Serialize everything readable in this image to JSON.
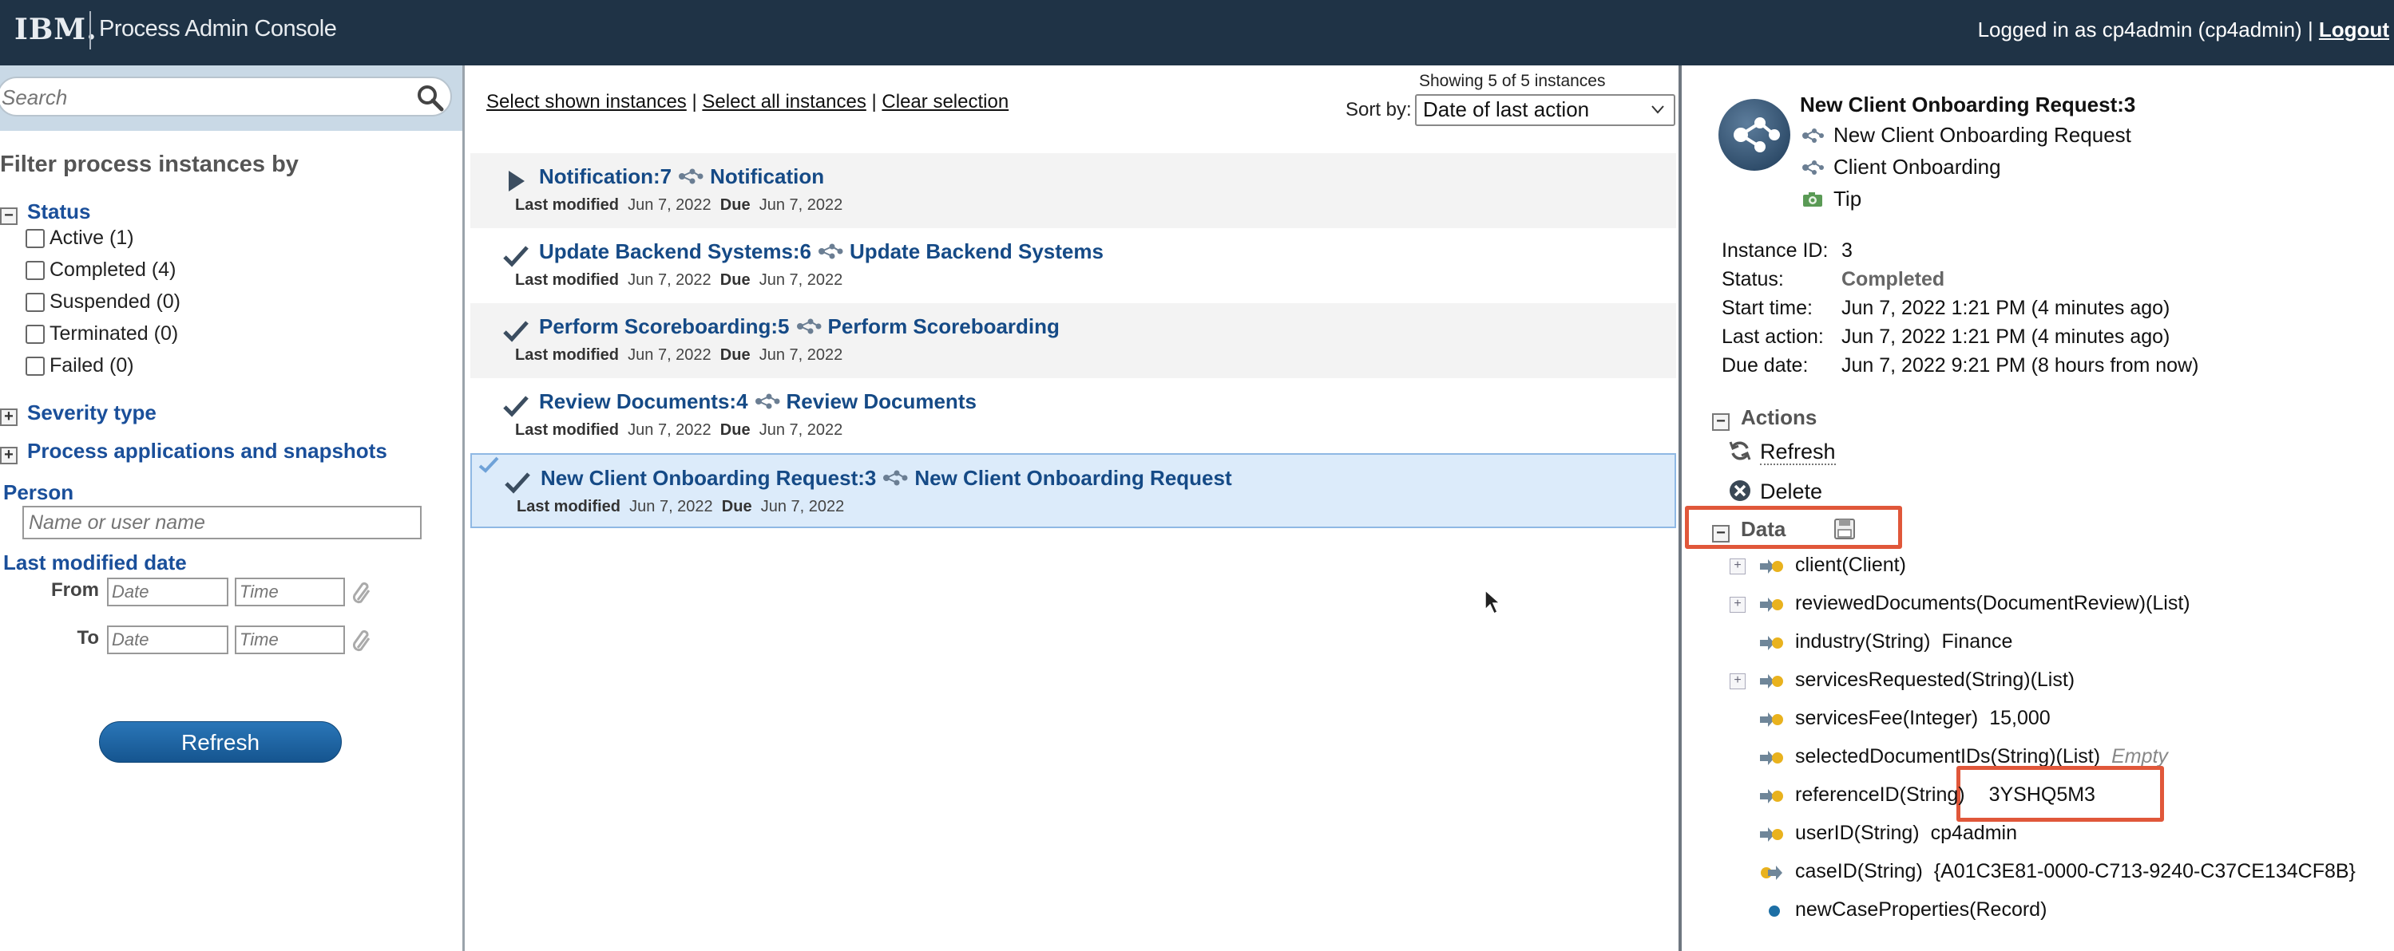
{
  "header": {
    "logo": "IBM.",
    "app_title": "Process Admin Console",
    "logged_in_text": "Logged in as cp4admin (cp4admin) | ",
    "logout_label": "Logout"
  },
  "left_panel": {
    "search_placeholder": "Search",
    "filter_title": "Filter process instances by",
    "status_section": "Status",
    "status_items": [
      "Active (1)",
      "Completed (4)",
      "Suspended (0)",
      "Terminated (0)",
      "Failed (0)"
    ],
    "severity_section": "Severity type",
    "apps_section": "Process applications and snapshots",
    "person_label": "Person",
    "person_placeholder": "Name or user name",
    "last_modified_label": "Last modified date",
    "from_label": "From",
    "to_label": "To",
    "date_placeholder": "Date",
    "time_placeholder": "Time",
    "refresh_label": "Refresh"
  },
  "middle_panel": {
    "select_shown": "Select shown instances",
    "select_all": "Select all instances",
    "clear_selection": "Clear selection",
    "separator": " | ",
    "showing": "Showing 5 of 5 instances",
    "sort_by_label": "Sort by:",
    "sort_value": "Date of last action",
    "last_modified_label": "Last modified",
    "due_label": "Due",
    "instances": [
      {
        "id_name": "Notification:7",
        "process": "Notification",
        "last_modified": "Jun 7, 2022",
        "due": "Jun 7, 2022",
        "state": "active"
      },
      {
        "id_name": "Update Backend Systems:6",
        "process": "Update Backend Systems",
        "last_modified": "Jun 7, 2022",
        "due": "Jun 7, 2022",
        "state": "completed"
      },
      {
        "id_name": "Perform Scoreboarding:5",
        "process": "Perform Scoreboarding",
        "last_modified": "Jun 7, 2022",
        "due": "Jun 7, 2022",
        "state": "completed"
      },
      {
        "id_name": "Review Documents:4",
        "process": "Review Documents",
        "last_modified": "Jun 7, 2022",
        "due": "Jun 7, 2022",
        "state": "completed"
      },
      {
        "id_name": "New Client Onboarding Request:3",
        "process": "New Client Onboarding Request",
        "last_modified": "Jun 7, 2022",
        "due": "Jun 7, 2022",
        "state": "completed"
      }
    ]
  },
  "right_panel": {
    "title": "New Client Onboarding Request:3",
    "process": "New Client Onboarding Request",
    "application": "Client Onboarding",
    "snapshot": "Tip",
    "details": {
      "instance_id_label": "Instance ID:",
      "instance_id": "3",
      "status_label": "Status:",
      "status": "Completed",
      "start_label": "Start time:",
      "start": "Jun 7, 2022 1:21 PM (4 minutes ago)",
      "last_action_label": "Last action:",
      "last_action": "Jun 7, 2022 1:21 PM (4 minutes ago)",
      "due_label": "Due date:",
      "due": "Jun 7, 2022 9:21 PM (8 hours from now)"
    },
    "actions_section": "Actions",
    "refresh_label": "Refresh",
    "delete_label": "Delete",
    "data_section": "Data",
    "data_rows": [
      {
        "label": "client(Client)",
        "value": "",
        "expandable": true
      },
      {
        "label": "reviewedDocuments(DocumentReview)(List)",
        "value": "",
        "expandable": true
      },
      {
        "label": "industry(String)",
        "value": "Finance",
        "expandable": false
      },
      {
        "label": "servicesRequested(String)(List)",
        "value": "",
        "expandable": true
      },
      {
        "label": "servicesFee(Integer)",
        "value": "15,000",
        "expandable": false
      },
      {
        "label": "selectedDocumentIDs(String)(List)",
        "value": "Empty",
        "expandable": false
      },
      {
        "label": "referenceID(String)",
        "value": "3YSHQ5M3",
        "expandable": false
      },
      {
        "label": "userID(String)",
        "value": "cp4admin",
        "expandable": false
      },
      {
        "label": "caseID(String)",
        "value": "{A01C3E81-0000-C713-9240-C37CE134CF8B}",
        "expandable": false
      },
      {
        "label": "newCaseProperties(Record)",
        "value": "",
        "expandable": false
      }
    ]
  },
  "colors": {
    "header_bg": "#1f3346",
    "link_blue": "#154a86",
    "highlight_red": "#e0573a",
    "selected_row": "#dcebfa"
  }
}
